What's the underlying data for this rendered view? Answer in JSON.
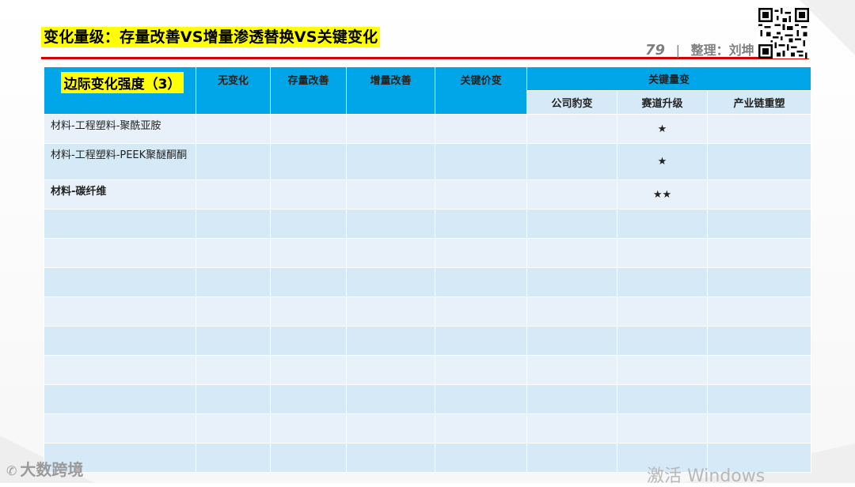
{
  "slide": {
    "title": "变化量级：存量改善VS增量渗透替换VS关键变化",
    "page_number": "79",
    "separator": "|",
    "compiler": "整理：刘坤"
  },
  "table": {
    "corner_label": "边际变化强度（3）",
    "headers": [
      "无变化",
      "存量改善",
      "增量改善",
      "关键价变",
      "关键量变"
    ],
    "sub_headers": [
      "公司豹变",
      "赛道升级",
      "产业链重塑"
    ],
    "rows": [
      {
        "label": "材料-工程塑料-聚酰亚胺",
        "bold": false,
        "cells": [
          "",
          "",
          "",
          "",
          "",
          "★",
          ""
        ]
      },
      {
        "label": "材料-工程塑料-PEEK聚醚酮酮",
        "bold": false,
        "cells": [
          "",
          "",
          "",
          "",
          "",
          "★",
          ""
        ]
      },
      {
        "label": "材料-碳纤维",
        "bold": true,
        "cells": [
          "",
          "",
          "",
          "",
          "",
          "★★",
          ""
        ]
      },
      {
        "label": "",
        "bold": false,
        "cells": [
          "",
          "",
          "",
          "",
          "",
          "",
          ""
        ]
      },
      {
        "label": "",
        "bold": false,
        "cells": [
          "",
          "",
          "",
          "",
          "",
          "",
          ""
        ]
      },
      {
        "label": "",
        "bold": false,
        "cells": [
          "",
          "",
          "",
          "",
          "",
          "",
          ""
        ]
      },
      {
        "label": "",
        "bold": false,
        "cells": [
          "",
          "",
          "",
          "",
          "",
          "",
          ""
        ]
      },
      {
        "label": "",
        "bold": false,
        "cells": [
          "",
          "",
          "",
          "",
          "",
          "",
          ""
        ]
      },
      {
        "label": "",
        "bold": false,
        "cells": [
          "",
          "",
          "",
          "",
          "",
          "",
          ""
        ]
      },
      {
        "label": "",
        "bold": false,
        "cells": [
          "",
          "",
          "",
          "",
          "",
          "",
          ""
        ]
      },
      {
        "label": "",
        "bold": false,
        "cells": [
          "",
          "",
          "",
          "",
          "",
          "",
          ""
        ]
      },
      {
        "label": "",
        "bold": false,
        "cells": [
          "",
          "",
          "",
          "",
          "",
          "",
          ""
        ]
      }
    ]
  },
  "watermarks": {
    "left": "大数跨境",
    "right": "激活 Windows"
  },
  "colors": {
    "header_blue": "#00a6e8",
    "highlight_yellow": "#ffff00",
    "rule_red": "#d50000",
    "star_red": "#e00000",
    "row_dark": "#d6e9f7",
    "row_light": "#e8f1fa"
  }
}
